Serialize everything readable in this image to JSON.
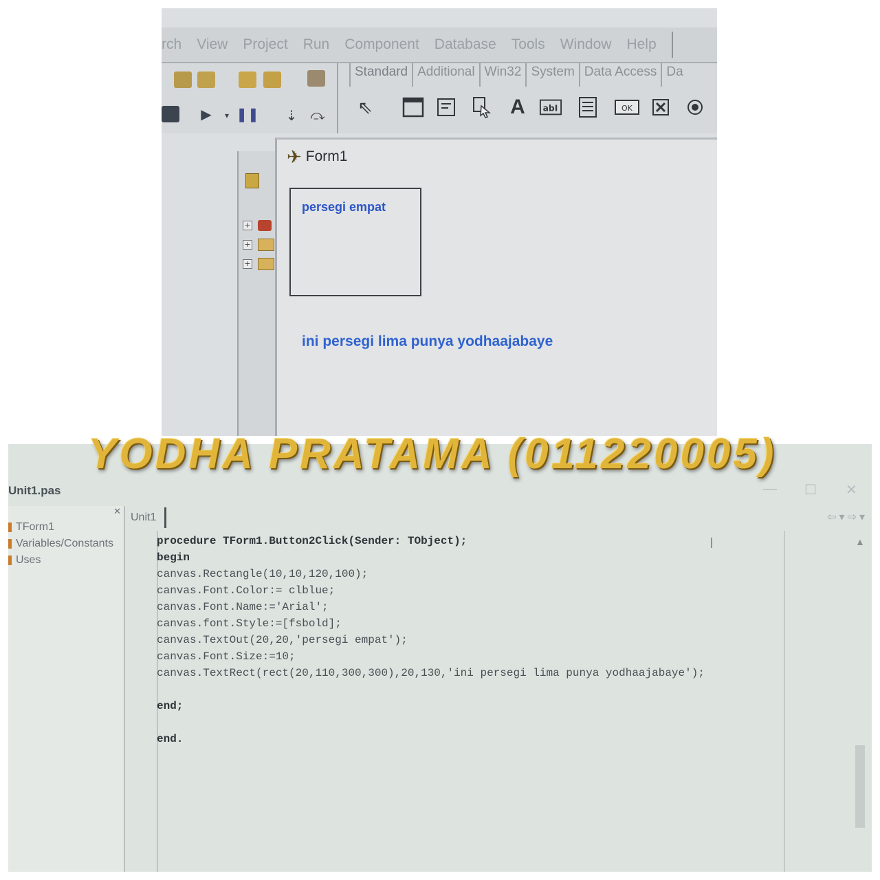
{
  "top": {
    "menu": [
      "rch",
      "View",
      "Project",
      "Run",
      "Component",
      "Database",
      "Tools",
      "Window",
      "Help"
    ],
    "palette_tabs": [
      "Standard",
      "Additional",
      "Win32",
      "System",
      "Data Access",
      "Da"
    ],
    "palette_icons": [
      "pointer-icon",
      "frame-icon",
      "main-menu-icon",
      "popup-menu-icon",
      "label-icon",
      "edit-icon",
      "memo-icon",
      "button-icon",
      "checkbox-icon",
      "radio-icon"
    ],
    "form": {
      "title": "Form1",
      "text_square": "persegi empat",
      "text_pentagon": "ini persegi lima punya yodhaajabaye",
      "text_color": "#2f62d0"
    }
  },
  "watermark": {
    "text": "Yodha pratama (011220005)",
    "color": "#e0b53a"
  },
  "editor": {
    "title": "Unit1.pas",
    "explorer_items": [
      "TForm1",
      "Variables/Constants",
      "Uses"
    ],
    "tab": "Unit1",
    "code": [
      "procedure TForm1.Button2Click(Sender: TObject);",
      "begin",
      "canvas.Rectangle(10,10,120,100);",
      "canvas.Font.Color:= clblue;",
      "canvas.Font.Name:='Arial';",
      "canvas.font.Style:=[fsbold];",
      "canvas.TextOut(20,20,'persegi empat');",
      "canvas.Font.Size:=10;",
      "canvas.TextRect(rect(20,110,300,300),20,130,'ini persegi lima punya yodhaajabaye');",
      "",
      "end;",
      "",
      "end."
    ]
  }
}
